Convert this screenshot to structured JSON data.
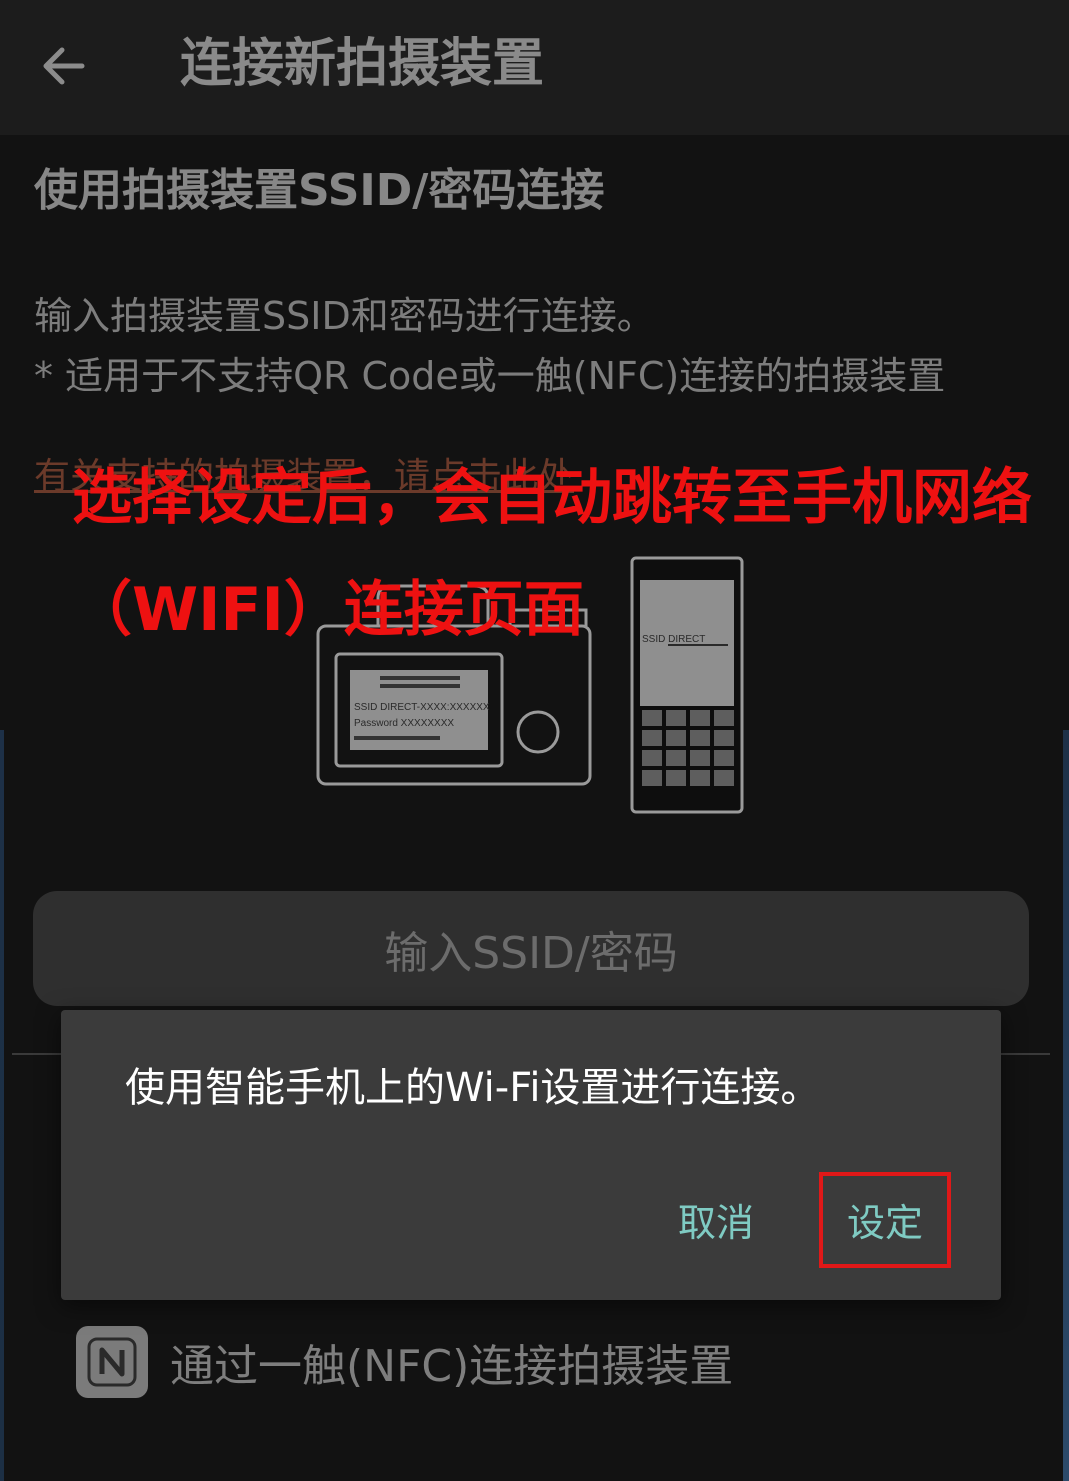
{
  "appbar": {
    "back_icon": "arrow-left-icon",
    "title": "连接新拍摄装置"
  },
  "section": {
    "title": "使用拍摄装置SSID/密码连接",
    "desc_line1": "输入拍摄装置SSID和密码进行连接。",
    "desc_line2": "* 适用于不支持QR Code或一触(NFC)连接的拍摄装置",
    "link_text": "有关支持的拍摄装置，请点击此处"
  },
  "annotation": {
    "text": "选择设定后，会自动跳转至手机网络（WIFI）连接页面",
    "color": "#ee1111"
  },
  "illustration": {
    "camera_lines": {
      "ssid": "SSID DIRECT-XXXX:XXXXXX",
      "password": "Password XXXXXXXX"
    },
    "phone_ssid": "SSID DIRECT"
  },
  "input_button": {
    "label": "输入SSID/密码"
  },
  "nfc": {
    "icon": "nfc-icon",
    "label": "通过一触(NFC)连接拍摄装置"
  },
  "dialog": {
    "message": "使用智能手机上的Wi-Fi设置进行连接。",
    "cancel_label": "取消",
    "ok_label": "设定",
    "accent_color": "#7fcbc3"
  }
}
